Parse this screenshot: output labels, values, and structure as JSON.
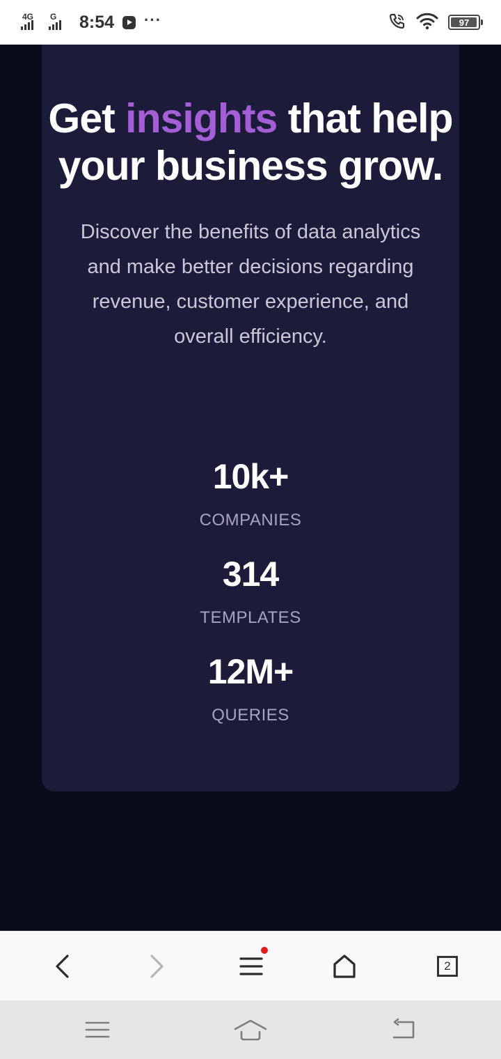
{
  "status_bar": {
    "network_1": "4G",
    "network_2": "G",
    "time": "8:54",
    "overflow": "···",
    "battery_level": "97",
    "icons": [
      "youtube-icon",
      "wifi-calling-icon",
      "wifi-icon",
      "battery-icon"
    ]
  },
  "hero": {
    "headline_before": "Get ",
    "headline_accent": "insights",
    "headline_after": " that help your business grow.",
    "description": "Discover the benefits of data analytics and make better decisions regarding revenue, customer experience, and overall efficiency."
  },
  "stats": [
    {
      "value": "10k+",
      "label": "COMPANIES"
    },
    {
      "value": "314",
      "label": "TEMPLATES"
    },
    {
      "value": "12M+",
      "label": "QUERIES"
    }
  ],
  "browser_toolbar": {
    "tab_count": "2",
    "has_notification": true,
    "icons": [
      "back-icon",
      "forward-icon",
      "menu-icon",
      "home-icon",
      "tabs-icon"
    ]
  },
  "system_nav": {
    "icons": [
      "recents-icon",
      "home-icon",
      "back-icon"
    ]
  },
  "colors": {
    "page_background": "#090b1a",
    "card_background": "#1c1b3a",
    "accent": "#a55fd6",
    "notification": "#e21b1b"
  }
}
